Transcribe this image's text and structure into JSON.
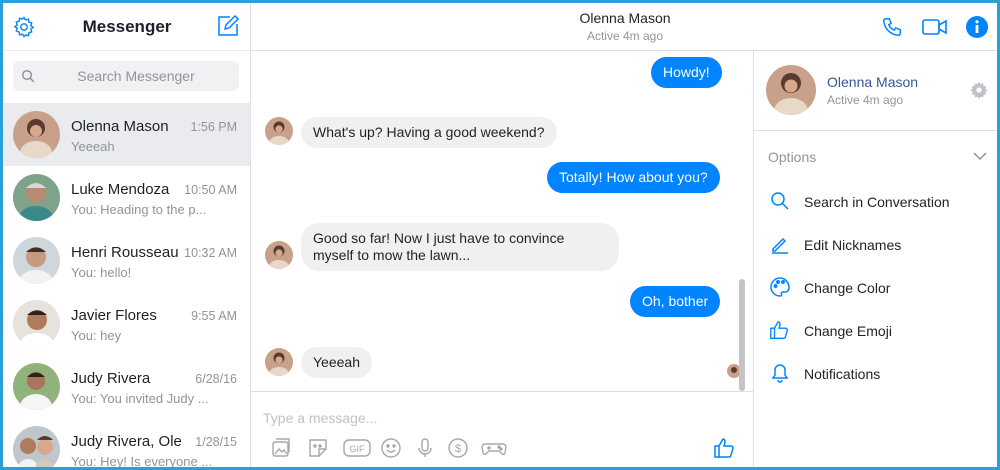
{
  "sidebar": {
    "title": "Messenger",
    "search_placeholder": "Search Messenger",
    "conversations": [
      {
        "name": "Olenna Mason",
        "time": "1:56 PM",
        "preview": "Yeeeah",
        "active": true
      },
      {
        "name": "Luke Mendoza",
        "time": "10:50 AM",
        "preview": "You: Heading to the p..."
      },
      {
        "name": "Henri Rousseau",
        "time": "10:32 AM",
        "preview": "You: hello!"
      },
      {
        "name": "Javier Flores",
        "time": "9:55 AM",
        "preview": "You: hey"
      },
      {
        "name": "Judy Rivera",
        "time": "6/28/16",
        "preview": "You: You invited Judy ..."
      },
      {
        "name": "Judy Rivera, Ole...",
        "time": "1/28/15",
        "preview": "You: Hey! Is everyone ..."
      }
    ]
  },
  "chat": {
    "contact_name": "Olenna Mason",
    "status": "Active 4m ago",
    "messages": [
      {
        "from": "me",
        "text": "Howdy!"
      },
      {
        "from": "them",
        "text": "What's up? Having a good weekend?"
      },
      {
        "from": "me",
        "text": "Totally! How about you?"
      },
      {
        "from": "them",
        "text": "Good so far! Now I just have to convince myself to mow the lawn..."
      },
      {
        "from": "me",
        "text": "Oh, bother"
      },
      {
        "from": "them",
        "text": "Yeeeah"
      }
    ],
    "composer_placeholder": "Type a message...",
    "tools": [
      "image-icon",
      "sticker-icon",
      "gif-icon",
      "emoji-icon",
      "microphone-icon",
      "payment-icon",
      "game-icon"
    ]
  },
  "details": {
    "name": "Olenna Mason",
    "status": "Active 4m ago",
    "options_label": "Options",
    "options": [
      {
        "label": "Search in Conversation",
        "icon": "search-icon"
      },
      {
        "label": "Edit Nicknames",
        "icon": "pencil-icon"
      },
      {
        "label": "Change Color",
        "icon": "palette-icon"
      },
      {
        "label": "Change Emoji",
        "icon": "thumbs-up-icon"
      },
      {
        "label": "Notifications",
        "icon": "bell-icon"
      }
    ]
  },
  "colors": {
    "accent": "#0084ff",
    "frame": "#2a9fd8",
    "incoming_bubble": "#f1f0f0",
    "link": "#365899"
  }
}
